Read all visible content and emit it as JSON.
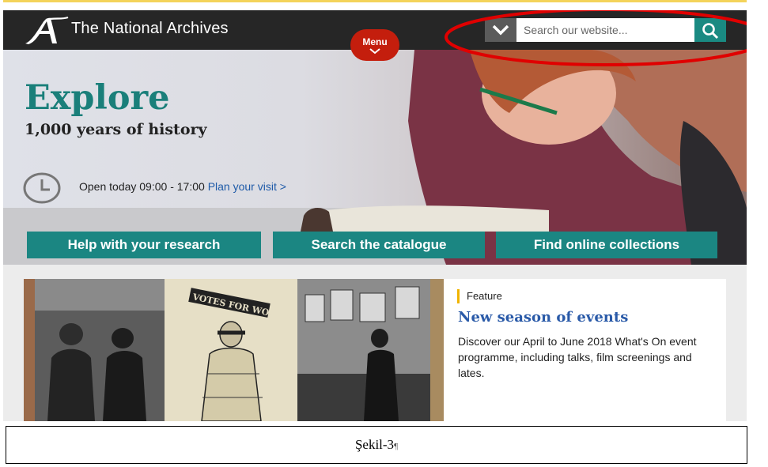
{
  "header": {
    "logo_text": "The National Archives",
    "menu_label": "Menu",
    "search": {
      "placeholder": "Search our website..."
    }
  },
  "hero": {
    "title": "Explore",
    "subtitle": "1,000 years of history",
    "opening": {
      "text": "Open today 09:00 - 17:00",
      "link": "Plan your visit >"
    },
    "actions": [
      "Help with your research",
      "Search the catalogue",
      "Find online collections"
    ]
  },
  "feature": {
    "tag": "Feature",
    "title": "New season of events",
    "description": "Discover our April to June 2018 What's On event programme, including talks, film screenings and lates.",
    "image_text": {
      "sign": "VOTES FOR WOMEN"
    }
  },
  "caption": {
    "label": "Şekil-3",
    "mark": "¶"
  },
  "colors": {
    "header_bg": "#262626",
    "accent_teal": "#1b8682",
    "menu_red": "#c41e0d",
    "link_blue": "#1e5aa8",
    "annotation_red": "#e00000",
    "feature_bar": "#f0b400"
  }
}
